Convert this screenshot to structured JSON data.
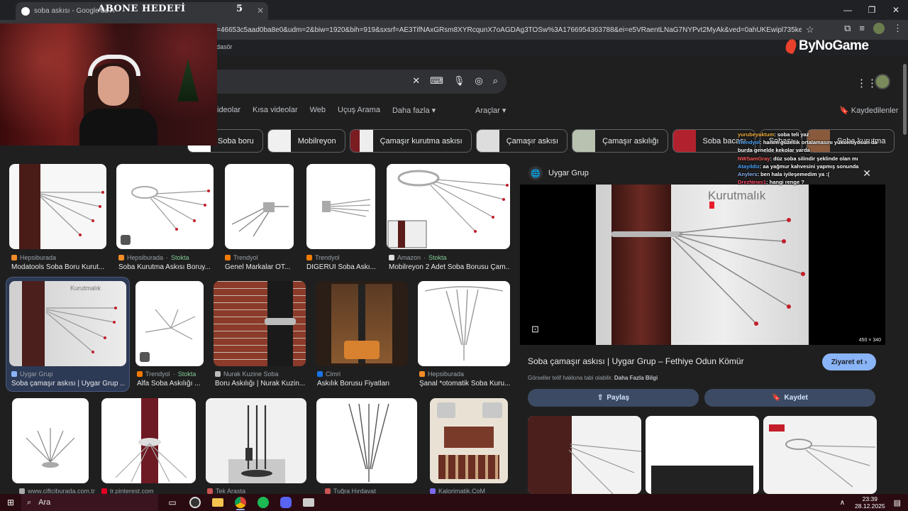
{
  "browser": {
    "tab_title": "soba askısı - Google'da A",
    "url": "y=46653c5aad0ba8e0&udm=2&biw=1920&bih=919&sxsrf=AE3TifNAxGRsm8XYRcqunX7oAGDAg3TOSw%3A1766954363788&ei=e5VRaentLNaG7NYPvt2MyAk&ved=0ahUKEwipl735keGRAxVWA9sE...",
    "bookmark": "dasör"
  },
  "overlay": {
    "subscribe_label": "ABONE HEDEFİ",
    "subscribe_count": "5",
    "brand": "ByNoGame"
  },
  "google": {
    "nav_tabs": [
      "ideolar",
      "Kısa videolar",
      "Web",
      "Uçuş Arama",
      "Daha fazla ▾"
    ],
    "tools": "Araçlar ▾",
    "saved": "Kaydedilenler",
    "chips": [
      "Soba boru",
      "Mobilreyon",
      "Çamaşır kurutma askısı",
      "Çamaşır askısı",
      "Çamaşır askılığı",
      "Soba bacası",
      "Sobası",
      "Soba kurutma"
    ]
  },
  "results": [
    {
      "source": "Hepsiburada",
      "stock": "",
      "caption": "Modatools Soba Boru Kurut..."
    },
    {
      "source": "Hepsiburada",
      "stock": "Stokta",
      "caption": "Soba Kurutma Askısı Boruy..."
    },
    {
      "source": "Trendyol",
      "stock": "",
      "caption": "Genel Markalar OT..."
    },
    {
      "source": "Trendyol",
      "stock": "",
      "caption": "DIGERUI Soba Askı..."
    },
    {
      "source": "Amazon",
      "stock": "Stokta",
      "caption": "Mobilreyon 2 Adet Soba Borusu Çam..."
    },
    {
      "source": "Uygar Grup",
      "stock": "",
      "caption": "Soba çamaşır askısı | Uygar Grup ..."
    },
    {
      "source": "Trendyol",
      "stock": "Stokta",
      "caption": "Alfa Soba Askılığı ..."
    },
    {
      "source": "Nurak Kuzine Soba",
      "stock": "",
      "caption": "Boru Askılığı | Nurak Kuzin..."
    },
    {
      "source": "Cimri",
      "stock": "",
      "caption": "Askılık Borusu Fiyatları"
    },
    {
      "source": "Hepsiburada",
      "stock": "",
      "caption": "Şanal *otomatik Soba Kuru..."
    },
    {
      "source": "www.ciftciburada.com.tr",
      "stock": "",
      "caption": ""
    },
    {
      "source": "tr.pinterest.com",
      "stock": "",
      "caption": ""
    },
    {
      "source": "Tek Arasta",
      "stock": "",
      "caption": ""
    },
    {
      "source": "Tuğra Hırdavat",
      "stock": "",
      "caption": ""
    },
    {
      "source": "Kalorimatik.CoM",
      "stock": "",
      "caption": ""
    }
  ],
  "panel": {
    "site": "Uygar Grup",
    "brand_in_image": "Kurutmalık",
    "dims": "450 × 340",
    "title": "Soba çamaşır askısı | Uygar Grup – Fethiye Odun Kömür",
    "visit": "Ziyaret et",
    "copyright": "Görseller telif hakkına tabi olabilir.",
    "more_info": "Daha Fazla Bilgi",
    "share": "Paylaş",
    "save": "Kaydet"
  },
  "chat": [
    {
      "user": "yurubeyaktum",
      "msg": ": soba teli yaz"
    },
    {
      "user": "Trendyol",
      "msg": ": hanım güzellik ortalamasını yükseltiyosun da"
    },
    {
      "user": "",
      "msg": "burda genelde kekolar varda"
    },
    {
      "user": "NWSamGray",
      "msg": ": düz soba silindir şeklinde olan mı"
    },
    {
      "user": "Atayildiz",
      "msg": ": aa yağmur kahvesini yapmış sonunda"
    },
    {
      "user": "Anylers",
      "msg": ": ben hala iyileşemedim ya :("
    },
    {
      "user": "DrezNewx1",
      "msg": ": hangi renge ?"
    }
  ],
  "taskbar": {
    "search": "Ara",
    "time": "23:39",
    "date": "28.12.2025"
  }
}
